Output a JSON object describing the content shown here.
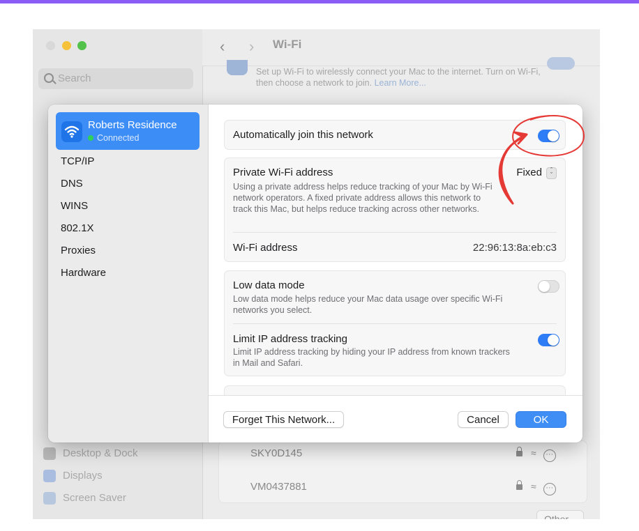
{
  "accent_color": "#2f7df6",
  "annotation_color": "#e53935",
  "background_window": {
    "title": "Wi-Fi",
    "search_placeholder": "Search",
    "intro_text": "Set up Wi-Fi to wirelessly connect your Mac to the internet. Turn on Wi-Fi, then choose a network to join.",
    "intro_link": "Learn More...",
    "sidebar_items": [
      "Desktop & Dock",
      "Displays",
      "Screen Saver"
    ],
    "networks": [
      "SKY0D145",
      "VM0437881"
    ],
    "other_button": "Other..."
  },
  "dialog": {
    "network": {
      "name": "Roberts Residence",
      "status": "Connected"
    },
    "sidebar": [
      "TCP/IP",
      "DNS",
      "WINS",
      "802.1X",
      "Proxies",
      "Hardware"
    ],
    "auto_join": {
      "label": "Automatically join this network",
      "enabled": true
    },
    "private_address": {
      "label": "Private Wi-Fi address",
      "value": "Fixed",
      "description": "Using a private address helps reduce tracking of your Mac by Wi-Fi network operators. A fixed private address allows this network to track this Mac, but helps reduce tracking across other networks."
    },
    "wifi_address": {
      "label": "Wi-Fi address",
      "value": "22:96:13:8a:eb:c3"
    },
    "low_data_mode": {
      "label": "Low data mode",
      "description": "Low data mode helps reduce your Mac data usage over specific Wi-Fi networks you select.",
      "enabled": false
    },
    "limit_ip_tracking": {
      "label": "Limit IP address tracking",
      "description": "Limit IP address tracking by hiding your IP address from known trackers in Mail and Safari.",
      "enabled": true
    },
    "buttons": {
      "forget": "Forget This Network...",
      "cancel": "Cancel",
      "ok": "OK"
    }
  }
}
